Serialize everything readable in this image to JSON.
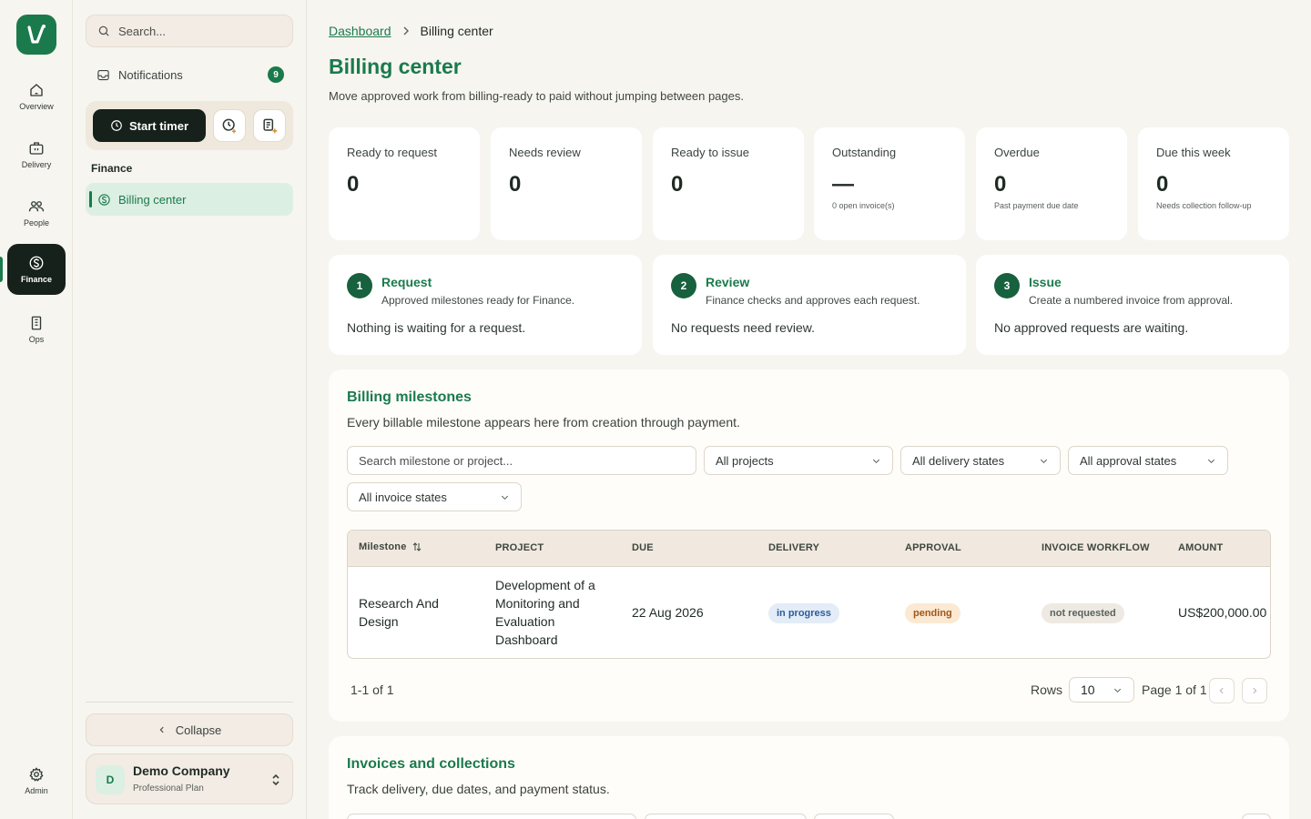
{
  "rail": {
    "items": [
      {
        "label": "Overview",
        "icon": "home-icon"
      },
      {
        "label": "Delivery",
        "icon": "briefcase-icon"
      },
      {
        "label": "People",
        "icon": "users-icon"
      },
      {
        "label": "Finance",
        "icon": "dollar-circle-icon"
      },
      {
        "label": "Ops",
        "icon": "building-icon"
      },
      {
        "label": "Admin",
        "icon": "gear-icon"
      }
    ],
    "active": "Finance"
  },
  "sidebar": {
    "search_placeholder": "Search...",
    "notifications": {
      "label": "Notifications",
      "count": "9"
    },
    "start_timer_label": "Start timer",
    "section_label": "Finance",
    "nav_item": "Billing center",
    "collapse_label": "Collapse",
    "company": {
      "initial": "D",
      "name": "Demo Company",
      "plan": "Professional Plan"
    }
  },
  "breadcrumb": {
    "parent": "Dashboard",
    "current": "Billing center"
  },
  "page": {
    "title": "Billing center",
    "subtitle": "Move approved work from billing-ready to paid without jumping between pages."
  },
  "stats": [
    {
      "label": "Ready to request",
      "value": "0",
      "note": ""
    },
    {
      "label": "Needs review",
      "value": "0",
      "note": ""
    },
    {
      "label": "Ready to issue",
      "value": "0",
      "note": ""
    },
    {
      "label": "Outstanding",
      "value": "—",
      "note": "0 open invoice(s)"
    },
    {
      "label": "Overdue",
      "value": "0",
      "note": "Past payment due date"
    },
    {
      "label": "Due this week",
      "value": "0",
      "note": "Needs collection follow-up"
    }
  ],
  "steps": [
    {
      "num": "1",
      "title": "Request",
      "desc": "Approved milestones ready for Finance.",
      "message": "Nothing is waiting for a request."
    },
    {
      "num": "2",
      "title": "Review",
      "desc": "Finance checks and approves each request.",
      "message": "No requests need review."
    },
    {
      "num": "3",
      "title": "Issue",
      "desc": "Create a numbered invoice from approval.",
      "message": "No approved requests are waiting."
    }
  ],
  "milestones": {
    "title": "Billing milestones",
    "subtitle": "Every billable milestone appears here from creation through payment.",
    "search_placeholder": "Search milestone or project...",
    "filters": {
      "projects": "All projects",
      "delivery": "All delivery states",
      "approval": "All approval states",
      "invoice": "All invoice states"
    },
    "columns": [
      "Milestone",
      "PROJECT",
      "DUE",
      "DELIVERY",
      "APPROVAL",
      "INVOICE WORKFLOW",
      "AMOUNT"
    ],
    "rows": [
      {
        "milestone_l1": "Research And",
        "milestone_l2": "Design",
        "project_l1": "Development of a",
        "project_l2": "Monitoring and",
        "project_l3": "Evaluation",
        "project_l4": "Dashboard",
        "due": "22 Aug 2026",
        "delivery": "in progress",
        "approval": "pending",
        "invoice": "not requested",
        "amount": "US$200,000.00"
      }
    ],
    "footer": {
      "range": "1-1 of 1",
      "rows_label": "Rows",
      "rows_value": "10",
      "page": "Page 1 of 1"
    }
  },
  "invoices": {
    "title": "Invoices and collections",
    "subtitle": "Track delivery, due dates, and payment status."
  },
  "colors": {
    "accent": "#1a7a4c",
    "dark": "#17211c",
    "background": "#f7f5f0"
  }
}
